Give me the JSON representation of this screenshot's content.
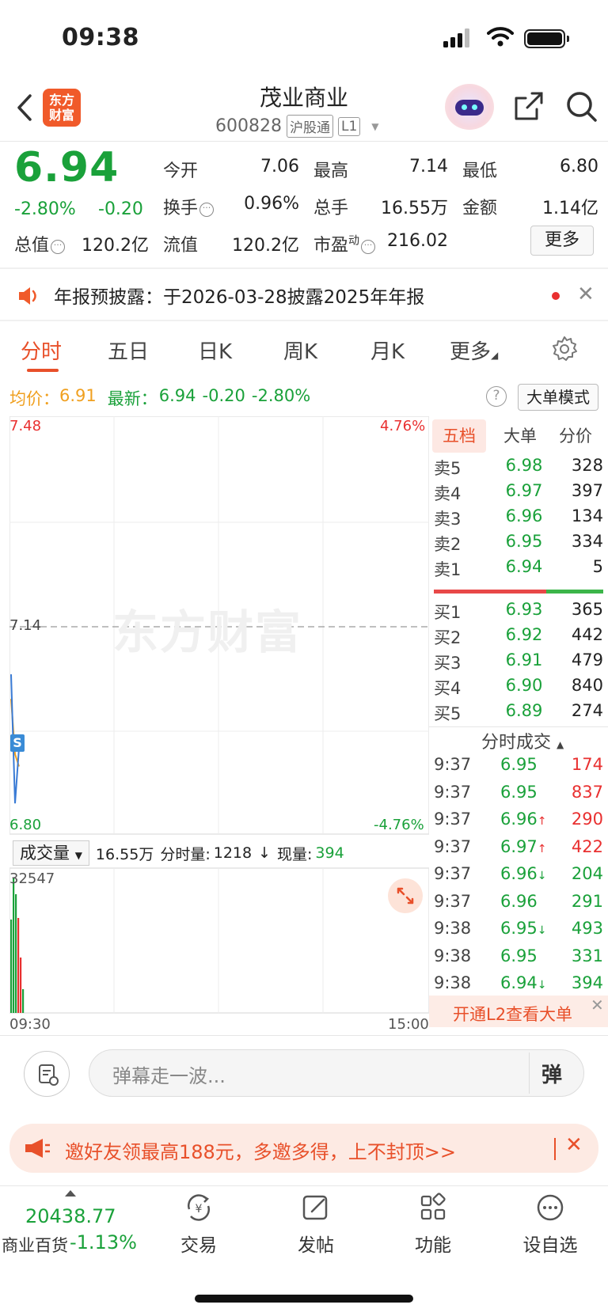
{
  "status": {
    "time": "09:38"
  },
  "header": {
    "logo": "东方\n财富",
    "title": "茂业商业",
    "code": "600828",
    "tag1": "沪股通",
    "tag2": "L1"
  },
  "quote": {
    "price": "6.94",
    "change_pct": "-2.80%",
    "change_abs": "-0.20",
    "open_label": "今开",
    "open": "7.06",
    "high_label": "最高",
    "high": "7.14",
    "low_label": "最低",
    "low": "6.80",
    "turnover_label": "换手",
    "turnover": "0.96%",
    "volume_label": "总手",
    "volume": "16.55万",
    "amount_label": "金额",
    "amount": "1.14亿",
    "mktcap_label": "总值",
    "mktcap": "120.2亿",
    "float_label": "流值",
    "float": "120.2亿",
    "pe_label": "市盈",
    "pe_sup": "动",
    "pe": "216.02",
    "more": "更多"
  },
  "notice": {
    "text": "年报预披露：于2026-03-28披露2025年年报"
  },
  "tabs": [
    "分时",
    "五日",
    "日K",
    "周K",
    "月K",
    "更多"
  ],
  "info": {
    "avg_label": "均价：",
    "avg": "6.91",
    "latest_label": "最新：",
    "latest": "6.94",
    "latest_chg": "-0.20",
    "latest_pct": "-2.80%",
    "big_mode": "大单模式"
  },
  "chart": {
    "y_top": "7.48",
    "y_mid": "7.14",
    "y_bot": "6.80",
    "pct_top": "4.76%",
    "pct_bot": "-4.76%",
    "watermark": "东方财富",
    "signal": "S",
    "vol_select": "成交量",
    "vol_total": "16.55万",
    "vol_min_label": "分时量:",
    "vol_min": "1218",
    "vol_now_label": "现量:",
    "vol_now": "394",
    "vol_max": "32547",
    "t_start": "09:30",
    "t_end": "15:00"
  },
  "chart_data": {
    "type": "line",
    "ylim": [
      6.8,
      7.48
    ],
    "ref_price": 7.14,
    "series": [
      {
        "name": "均价",
        "values": [
          7.02,
          6.93,
          6.91
        ]
      },
      {
        "name": "最新",
        "values": [
          7.06,
          6.85,
          6.94
        ]
      }
    ]
  },
  "orderbook": {
    "headers": [
      "五档",
      "大单",
      "分价"
    ],
    "sells": [
      {
        "label": "卖5",
        "price": "6.98",
        "vol": "328"
      },
      {
        "label": "卖4",
        "price": "6.97",
        "vol": "397"
      },
      {
        "label": "卖3",
        "price": "6.96",
        "vol": "134"
      },
      {
        "label": "卖2",
        "price": "6.95",
        "vol": "334"
      },
      {
        "label": "卖1",
        "price": "6.94",
        "vol": "5"
      }
    ],
    "buys": [
      {
        "label": "买1",
        "price": "6.93",
        "vol": "365"
      },
      {
        "label": "买2",
        "price": "6.92",
        "vol": "442"
      },
      {
        "label": "买3",
        "price": "6.91",
        "vol": "479"
      },
      {
        "label": "买4",
        "price": "6.90",
        "vol": "840"
      },
      {
        "label": "买5",
        "price": "6.89",
        "vol": "274"
      }
    ]
  },
  "ticks": {
    "title": "分时成交",
    "rows": [
      {
        "time": "9:37",
        "price": "6.95",
        "arrow": "",
        "vol": "174",
        "dir": "red"
      },
      {
        "time": "9:37",
        "price": "6.95",
        "arrow": "",
        "vol": "837",
        "dir": "red"
      },
      {
        "time": "9:37",
        "price": "6.96",
        "arrow": "↑",
        "vol": "290",
        "dir": "red"
      },
      {
        "time": "9:37",
        "price": "6.97",
        "arrow": "↑",
        "vol": "422",
        "dir": "red"
      },
      {
        "time": "9:37",
        "price": "6.96",
        "arrow": "↓",
        "vol": "204",
        "dir": "green"
      },
      {
        "time": "9:37",
        "price": "6.96",
        "arrow": "",
        "vol": "291",
        "dir": "green"
      },
      {
        "time": "9:38",
        "price": "6.95",
        "arrow": "↓",
        "vol": "493",
        "dir": "green"
      },
      {
        "time": "9:38",
        "price": "6.95",
        "arrow": "",
        "vol": "331",
        "dir": "green"
      },
      {
        "time": "9:38",
        "price": "6.94",
        "arrow": "↓",
        "vol": "394",
        "dir": "green"
      }
    ],
    "l2_text": "开通L2查看大单"
  },
  "danmu": {
    "placeholder": "弹幕走一波...",
    "button": "弹"
  },
  "promo": {
    "text": "邀好友领最高188元，多邀多得，上不封顶>>"
  },
  "bottom": {
    "index_value": "20438.77",
    "index_name": "商业百货",
    "index_change": "-1.13%",
    "nav": [
      "交易",
      "发帖",
      "功能",
      "设自选"
    ]
  }
}
